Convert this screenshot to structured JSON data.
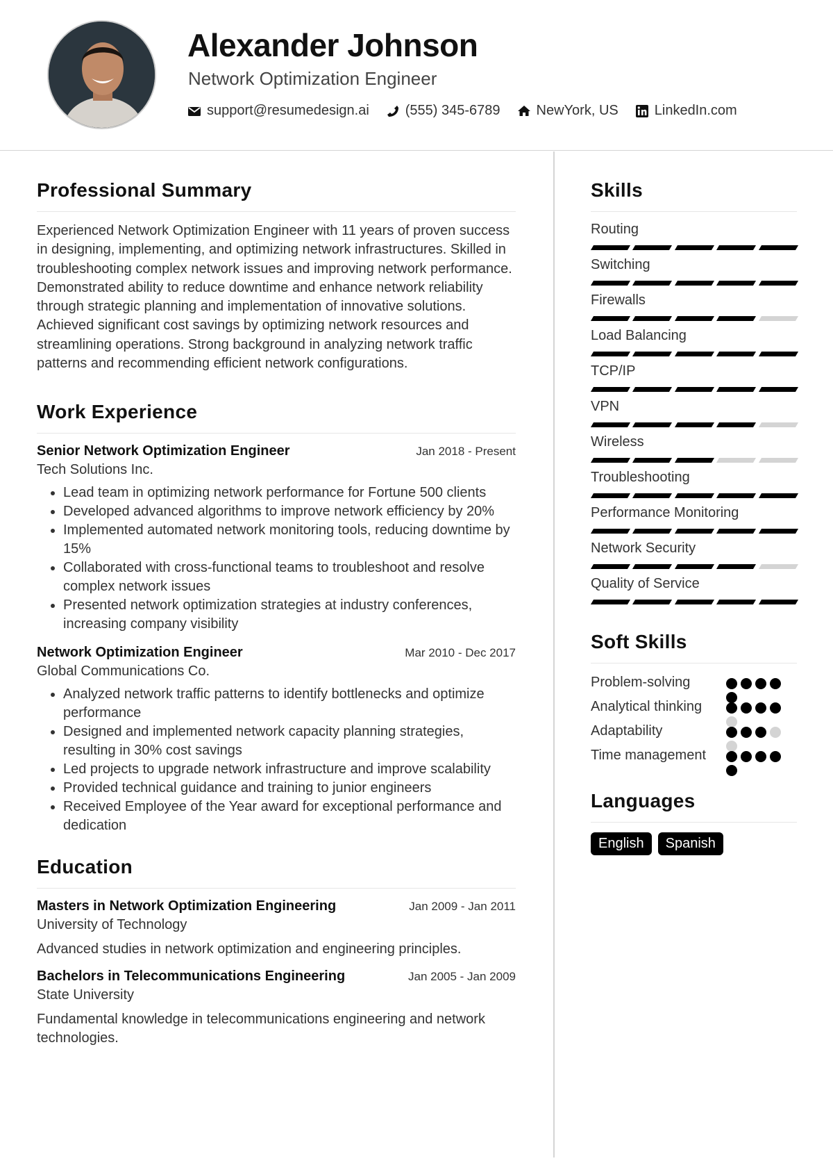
{
  "header": {
    "name": "Alexander Johnson",
    "title": "Network Optimization Engineer",
    "contacts": [
      {
        "icon": "envelope-icon",
        "text": "support@resumedesign.ai"
      },
      {
        "icon": "phone-icon",
        "text": "(555) 345-6789"
      },
      {
        "icon": "home-icon",
        "text": "NewYork, US"
      },
      {
        "icon": "linkedin-icon",
        "text": "LinkedIn.com"
      }
    ]
  },
  "summary": {
    "heading": "Professional Summary",
    "text": "Experienced Network Optimization Engineer with 11 years of proven success in designing, implementing, and optimizing network infrastructures. Skilled in troubleshooting complex network issues and improving network performance. Demonstrated ability to reduce downtime and enhance network reliability through strategic planning and implementation of innovative solutions. Achieved significant cost savings by optimizing network resources and streamlining operations. Strong background in analyzing network traffic patterns and recommending efficient network configurations."
  },
  "experience": {
    "heading": "Work Experience",
    "jobs": [
      {
        "title": "Senior Network Optimization Engineer",
        "date": "Jan 2018 - Present",
        "company": "Tech Solutions Inc.",
        "bullets": [
          "Lead team in optimizing network performance for Fortune 500 clients",
          "Developed advanced algorithms to improve network efficiency by 20%",
          "Implemented automated network monitoring tools, reducing downtime by 15%",
          "Collaborated with cross-functional teams to troubleshoot and resolve complex network issues",
          "Presented network optimization strategies at industry conferences, increasing company visibility"
        ]
      },
      {
        "title": "Network Optimization Engineer",
        "date": "Mar 2010 - Dec 2017",
        "company": "Global Communications Co.",
        "bullets": [
          "Analyzed network traffic patterns to identify bottlenecks and optimize performance",
          "Designed and implemented network capacity planning strategies, resulting in 30% cost savings",
          "Led projects to upgrade network infrastructure and improve scalability",
          "Provided technical guidance and training to junior engineers",
          "Received Employee of the Year award for exceptional performance and dedication"
        ]
      }
    ]
  },
  "education": {
    "heading": "Education",
    "items": [
      {
        "degree": "Masters in Network Optimization Engineering",
        "date": "Jan 2009 - Jan 2011",
        "school": "University of Technology",
        "desc": "Advanced studies in network optimization and engineering principles."
      },
      {
        "degree": "Bachelors in Telecommunications Engineering",
        "date": "Jan 2005 - Jan 2009",
        "school": "State University",
        "desc": "Fundamental knowledge in telecommunications engineering and network technologies."
      }
    ]
  },
  "skills": {
    "heading": "Skills",
    "max": 5,
    "items": [
      {
        "name": "Routing",
        "level": 5
      },
      {
        "name": "Switching",
        "level": 5
      },
      {
        "name": "Firewalls",
        "level": 4
      },
      {
        "name": "Load Balancing",
        "level": 5
      },
      {
        "name": "TCP/IP",
        "level": 5
      },
      {
        "name": "VPN",
        "level": 4
      },
      {
        "name": "Wireless",
        "level": 3
      },
      {
        "name": "Troubleshooting",
        "level": 5
      },
      {
        "name": "Performance Monitoring",
        "level": 5
      },
      {
        "name": "Network Security",
        "level": 4
      },
      {
        "name": "Quality of Service",
        "level": 5
      }
    ]
  },
  "soft_skills": {
    "heading": "Soft Skills",
    "max": 5,
    "items": [
      {
        "name": "Problem-solving",
        "level": 5
      },
      {
        "name": "Analytical thinking",
        "level": 4
      },
      {
        "name": "Adaptability",
        "level": 3
      },
      {
        "name": "Time management",
        "level": 5
      }
    ]
  },
  "languages": {
    "heading": "Languages",
    "items": [
      "English",
      "Spanish"
    ]
  }
}
